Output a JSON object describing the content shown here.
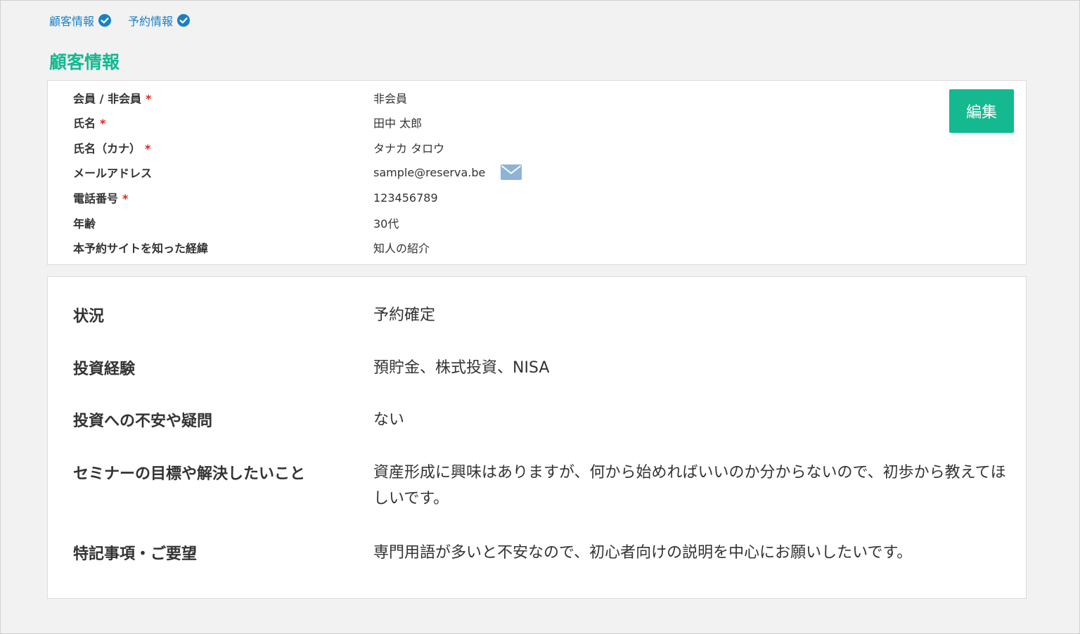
{
  "tabs": [
    {
      "label": "顧客情報",
      "icon": "check-circle-icon"
    },
    {
      "label": "予約情報",
      "icon": "check-circle-icon"
    }
  ],
  "section_title": "顧客情報",
  "edit_button": "編集",
  "required_mark": "*",
  "customer": [
    {
      "label": "会員 / 非会員",
      "value": "非会員",
      "required": true
    },
    {
      "label": "氏名",
      "value": "田中 太郎",
      "required": true
    },
    {
      "label": "氏名（カナ）",
      "value": "タナカ タロウ",
      "required": true
    },
    {
      "label": "メールアドレス",
      "value": "sample@reserva.be",
      "required": false,
      "icon": "mail-icon"
    },
    {
      "label": "電話番号",
      "value": "123456789",
      "required": true
    },
    {
      "label": "年齢",
      "value": "30代",
      "required": false
    },
    {
      "label": "本予約サイトを知った経緯",
      "value": "知人の紹介",
      "required": false
    }
  ],
  "details": [
    {
      "label": "状況",
      "value": "予約確定"
    },
    {
      "label": "投資経験",
      "value": "預貯金、株式投資、NISA"
    },
    {
      "label": "投資への不安や疑問",
      "value": "ない"
    },
    {
      "label": "セミナーの目標や解決したいこと",
      "value": "資産形成に興味はありますが、何から始めればいいのか分からないので、初歩から教えてほしいです。"
    },
    {
      "label": "特記事項・ご要望",
      "value": "専門用語が多いと不安なので、初心者向けの説明を中心にお願いしたいです。"
    }
  ],
  "colors": {
    "accent": "#14b990",
    "link": "#1a80c4",
    "required": "#e02020",
    "mail_icon": "#8db4d6"
  }
}
